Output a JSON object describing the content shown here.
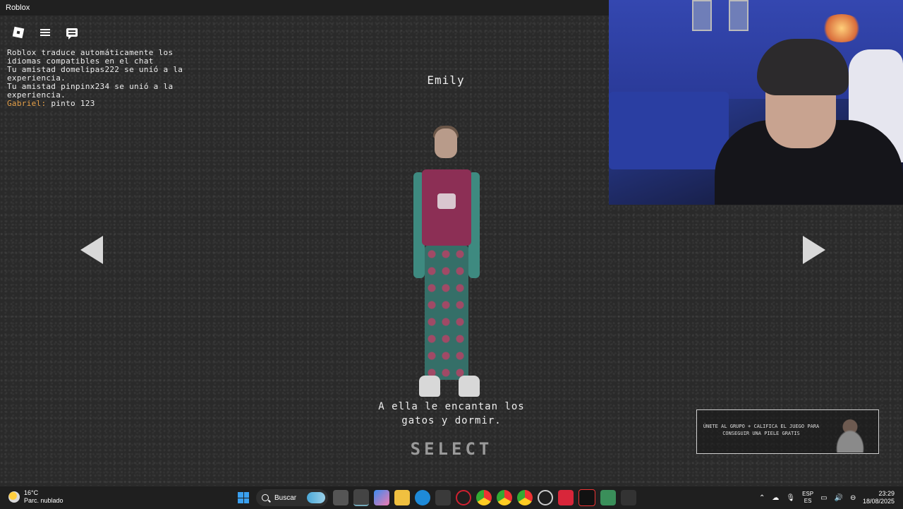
{
  "window": {
    "title": "Roblox"
  },
  "chat": {
    "system_msg": "Roblox traduce automáticamente los idiomas compatibles en el chat",
    "join1": "Tu amistad domelipas222 se unió a la experiencia.",
    "join2": "Tu amistad pinpinx234 se unió a la experiencia.",
    "user_name": "Gabriel:",
    "user_text": "pinto 123"
  },
  "character": {
    "name": "Emily",
    "description_line1": "A ella le encantan los",
    "description_line2": "gatos y dormir.",
    "select_label": "SELECT"
  },
  "promo": {
    "text": "ÚNETE AL GRUPO + CALIFICA EL JUEGO PARA CONSEGUIR UNA PIELE GRATIS"
  },
  "taskbar": {
    "weather_temp": "16°C",
    "weather_desc": "Parc. nublado",
    "search_placeholder": "Buscar",
    "lang_top": "ESP",
    "lang_bottom": "ES",
    "time": "23:29",
    "date": "18/08/2025"
  },
  "icons": {
    "roblox": "roblox-logo-icon",
    "menu": "hamburger-icon",
    "chat": "chat-icon",
    "prev": "left-arrow-icon",
    "next": "right-arrow-icon"
  }
}
